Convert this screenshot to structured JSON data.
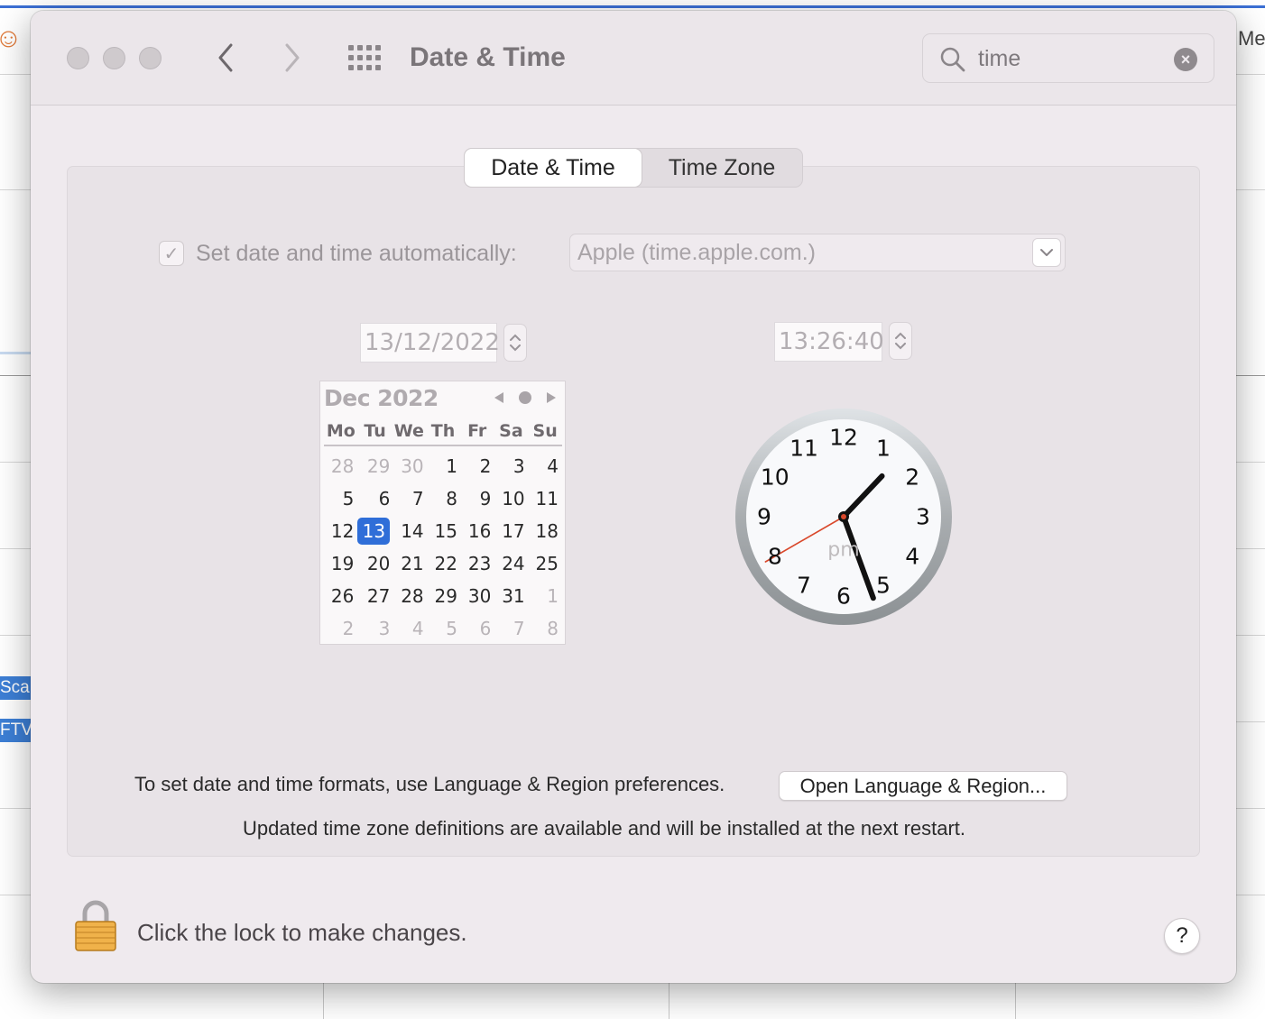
{
  "window": {
    "title": "Date & Time"
  },
  "search": {
    "value": "time",
    "clear_symbol": "×"
  },
  "tabs": [
    {
      "label": "Date & Time",
      "active": true
    },
    {
      "label": "Time Zone",
      "active": false
    }
  ],
  "auto_time": {
    "checked": true,
    "check_glyph": "✓",
    "label": "Set date and time automatically:",
    "server": "Apple (time.apple.com.)"
  },
  "date_field": "13/12/2022",
  "time_field": "13:26:40",
  "calendar": {
    "month_label": "Dec 2022",
    "weekdays": [
      "Mo",
      "Tu",
      "We",
      "Th",
      "Fr",
      "Sa",
      "Su"
    ],
    "weeks": [
      [
        "28",
        "29",
        "30",
        "1",
        "2",
        "3",
        "4"
      ],
      [
        "5",
        "6",
        "7",
        "8",
        "9",
        "10",
        "11"
      ],
      [
        "12",
        "13",
        "14",
        "15",
        "16",
        "17",
        "18"
      ],
      [
        "19",
        "20",
        "21",
        "22",
        "23",
        "24",
        "25"
      ],
      [
        "26",
        "27",
        "28",
        "29",
        "30",
        "31",
        "1"
      ],
      [
        "2",
        "3",
        "4",
        "5",
        "6",
        "7",
        "8"
      ]
    ],
    "selected_day": "13"
  },
  "clock": {
    "numbers": [
      "12",
      "1",
      "2",
      "3",
      "4",
      "5",
      "6",
      "7",
      "8",
      "9",
      "10",
      "11"
    ],
    "period": "pm",
    "hours": 13,
    "minutes": 26,
    "seconds": 40
  },
  "formats": {
    "text": "To set date and time formats, use Language & Region preferences.",
    "button": "Open Language & Region..."
  },
  "timezone_notice": "Updated time zone definitions are available and will be installed at the next restart.",
  "lock": {
    "text": "Click the lock to make changes."
  },
  "help": {
    "label": "?"
  },
  "background": {
    "menu_fragment": "Me",
    "tag_1": "Scal",
    "tag_2": "FTV"
  },
  "colors": {
    "accent": "#2f6ed8",
    "second_hand": "#d9482b"
  }
}
